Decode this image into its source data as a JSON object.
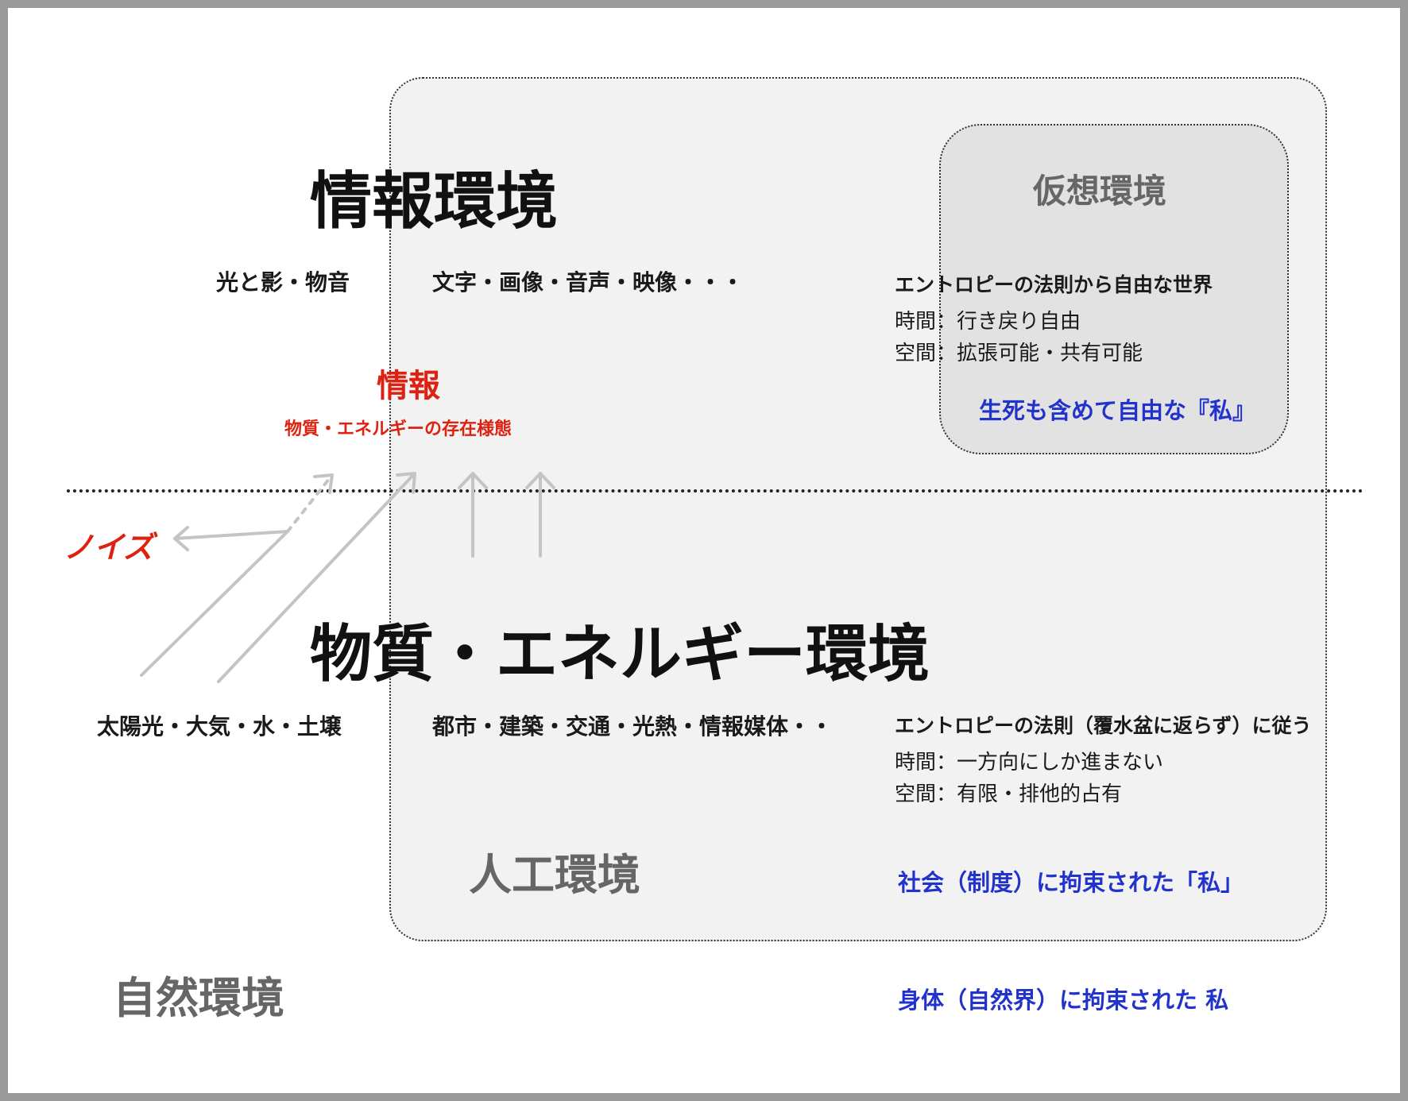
{
  "colors": {
    "accent_red": "#dd2211",
    "accent_blue": "#2233cc",
    "box_fill": "#f2f2f2",
    "virtual_fill": "#e2e2e2"
  },
  "info_env": {
    "title": "情報環境",
    "left_items": "光と影・物音",
    "middle_items": "文字・画像・音声・映像・・・",
    "law": "エントロピーの法則から自由な世界",
    "time": "時間：行き戻り自由",
    "space": "空間：拡張可能・共有可能",
    "self": "生死も含めて自由な『私』"
  },
  "virtual_env": {
    "title": "仮想環境"
  },
  "info_def": {
    "title": "情報",
    "subtitle": "物質・エネルギーの存在様態"
  },
  "noise": {
    "label": "ノイズ"
  },
  "matter_env": {
    "title": "物質・エネルギー環境",
    "left_items": "太陽光・大気・水・土壌",
    "middle_items": "都市・建築・交通・光熱・情報媒体・・",
    "law": "エントロピーの法則（覆水盆に返らず）に従う",
    "time": "時間：一方向にしか進まない",
    "space": "空間：有限・排他的占有",
    "self": "社会（制度）に拘束された「私」"
  },
  "artificial_env": {
    "title": "人工環境"
  },
  "natural_env": {
    "title": "自然環境",
    "self": "身体（自然界）に拘束された  私"
  }
}
